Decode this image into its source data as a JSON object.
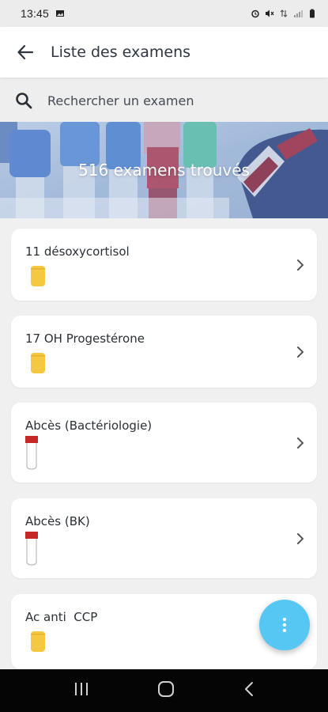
{
  "status_bar": {
    "time": "13:45",
    "left_icons": [
      "image-icon"
    ],
    "right_icons": [
      "alarm-icon",
      "mute-icon",
      "data-icon",
      "signal-icon",
      "battery-icon"
    ]
  },
  "app_bar": {
    "title": "Liste des examens",
    "back_icon": "arrow-left-icon"
  },
  "search": {
    "placeholder": "Rechercher un examen",
    "icon": "search-icon"
  },
  "banner": {
    "text": "516 examens trouvés"
  },
  "exams": [
    {
      "label": "11 désoxycortisol",
      "tube": "yellow"
    },
    {
      "label": "17 OH Progestérone",
      "tube": "yellow"
    },
    {
      "label": "Abcès (Bactériologie)",
      "tube": "red"
    },
    {
      "label": "Abcès (BK)",
      "tube": "red"
    },
    {
      "label": "Ac anti  CCP",
      "tube": "yellow"
    }
  ],
  "fab": {
    "icon": "more-vertical-icon",
    "color": "#56c7f3"
  },
  "colors": {
    "tube_yellow": "#f5c842",
    "tube_red": "#c62828",
    "accent": "#56c7f3"
  },
  "nav_bar": {
    "icons": [
      "recents-icon",
      "home-icon",
      "back-icon"
    ]
  }
}
